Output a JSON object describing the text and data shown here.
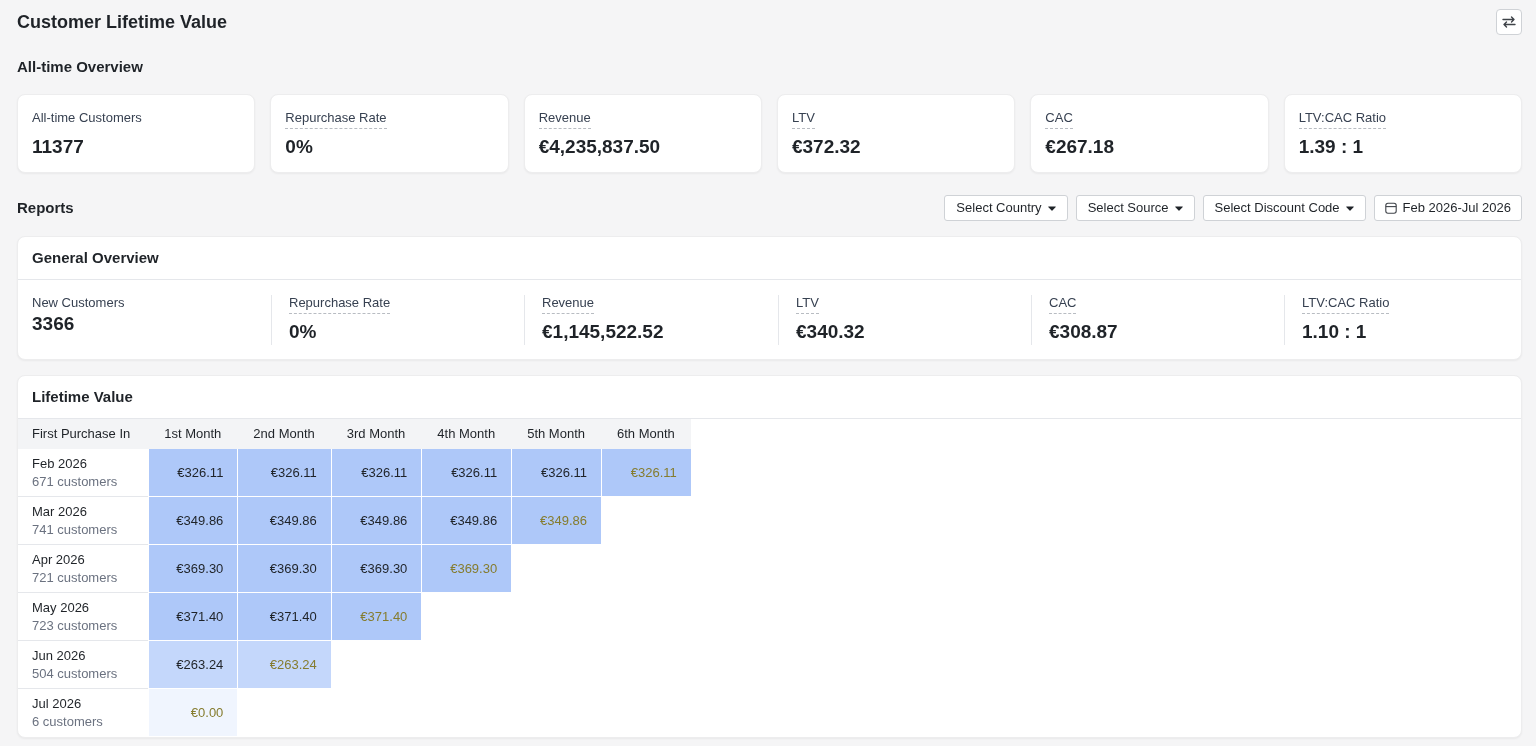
{
  "header": {
    "title": "Customer Lifetime Value"
  },
  "all_time_overview": {
    "heading": "All-time Overview",
    "cards": [
      {
        "label": "All-time Customers",
        "value": "11377",
        "underlined": false
      },
      {
        "label": "Repurchase Rate",
        "value": "0%",
        "underlined": true
      },
      {
        "label": "Revenue",
        "value": "€4,235,837.50",
        "underlined": true
      },
      {
        "label": "LTV",
        "value": "€372.32",
        "underlined": true
      },
      {
        "label": "CAC",
        "value": "€267.18",
        "underlined": true
      },
      {
        "label": "LTV:CAC Ratio",
        "value": "1.39 : 1",
        "underlined": true
      }
    ]
  },
  "reports": {
    "heading": "Reports",
    "filters": [
      {
        "kind": "dropdown",
        "label": "Select Country"
      },
      {
        "kind": "dropdown",
        "label": "Select Source"
      },
      {
        "kind": "dropdown",
        "label": "Select Discount Code"
      },
      {
        "kind": "date",
        "label": "Feb 2026-Jul 2026"
      }
    ]
  },
  "general_overview": {
    "title": "General Overview",
    "metrics": [
      {
        "label": "New Customers",
        "value": "3366",
        "underlined": false
      },
      {
        "label": "Repurchase Rate",
        "value": "0%",
        "underlined": true
      },
      {
        "label": "Revenue",
        "value": "€1,145,522.52",
        "underlined": true
      },
      {
        "label": "LTV",
        "value": "€340.32",
        "underlined": true
      },
      {
        "label": "CAC",
        "value": "€308.87",
        "underlined": true
      },
      {
        "label": "LTV:CAC Ratio",
        "value": "1.10 : 1",
        "underlined": true
      }
    ]
  },
  "lifetime_value": {
    "title": "Lifetime Value",
    "columns": [
      "First Purchase In",
      "1st Month",
      "2nd Month",
      "3rd Month",
      "4th Month",
      "5th Month",
      "6th Month"
    ],
    "rows": [
      {
        "cells": [
          {
            "kind": "cohort",
            "month": "Feb 2026",
            "customers": "671 customers"
          },
          {
            "kind": "value",
            "value": "€326.11",
            "color": "#aec8f9",
            "partial": false
          },
          {
            "kind": "value",
            "value": "€326.11",
            "color": "#aec8f9",
            "partial": false
          },
          {
            "kind": "value",
            "value": "€326.11",
            "color": "#aec8f9",
            "partial": false
          },
          {
            "kind": "value",
            "value": "€326.11",
            "color": "#aec8f9",
            "partial": false
          },
          {
            "kind": "value",
            "value": "€326.11",
            "color": "#aec8f9",
            "partial": false
          },
          {
            "kind": "value",
            "value": "€326.11",
            "color": "#aec8f9",
            "partial": true
          }
        ]
      },
      {
        "cells": [
          {
            "kind": "cohort",
            "month": "Mar 2026",
            "customers": "741 customers"
          },
          {
            "kind": "value",
            "value": "€349.86",
            "color": "#aec8f9",
            "partial": false
          },
          {
            "kind": "value",
            "value": "€349.86",
            "color": "#aec8f9",
            "partial": false
          },
          {
            "kind": "value",
            "value": "€349.86",
            "color": "#aec8f9",
            "partial": false
          },
          {
            "kind": "value",
            "value": "€349.86",
            "color": "#aec8f9",
            "partial": false
          },
          {
            "kind": "value",
            "value": "€349.86",
            "color": "#aec8f9",
            "partial": true
          }
        ]
      },
      {
        "cells": [
          {
            "kind": "cohort",
            "month": "Apr 2026",
            "customers": "721 customers"
          },
          {
            "kind": "value",
            "value": "€369.30",
            "color": "#aec8f9",
            "partial": false
          },
          {
            "kind": "value",
            "value": "€369.30",
            "color": "#aec8f9",
            "partial": false
          },
          {
            "kind": "value",
            "value": "€369.30",
            "color": "#aec8f9",
            "partial": false
          },
          {
            "kind": "value",
            "value": "€369.30",
            "color": "#aec8f9",
            "partial": true
          }
        ]
      },
      {
        "cells": [
          {
            "kind": "cohort",
            "month": "May 2026",
            "customers": "723 customers"
          },
          {
            "kind": "value",
            "value": "€371.40",
            "color": "#aec8f9",
            "partial": false
          },
          {
            "kind": "value",
            "value": "€371.40",
            "color": "#aec8f9",
            "partial": false
          },
          {
            "kind": "value",
            "value": "€371.40",
            "color": "#aec8f9",
            "partial": true
          }
        ]
      },
      {
        "cells": [
          {
            "kind": "cohort",
            "month": "Jun 2026",
            "customers": "504 customers"
          },
          {
            "kind": "value",
            "value": "€263.24",
            "color": "#c4d7fb",
            "partial": false
          },
          {
            "kind": "value",
            "value": "€263.24",
            "color": "#c4d7fb",
            "partial": true
          }
        ]
      },
      {
        "cells": [
          {
            "kind": "cohort",
            "month": "Jul 2026",
            "customers": "6 customers"
          },
          {
            "kind": "value",
            "value": "€0.00",
            "color": "#f0f5fe",
            "partial": true
          }
        ]
      }
    ]
  }
}
